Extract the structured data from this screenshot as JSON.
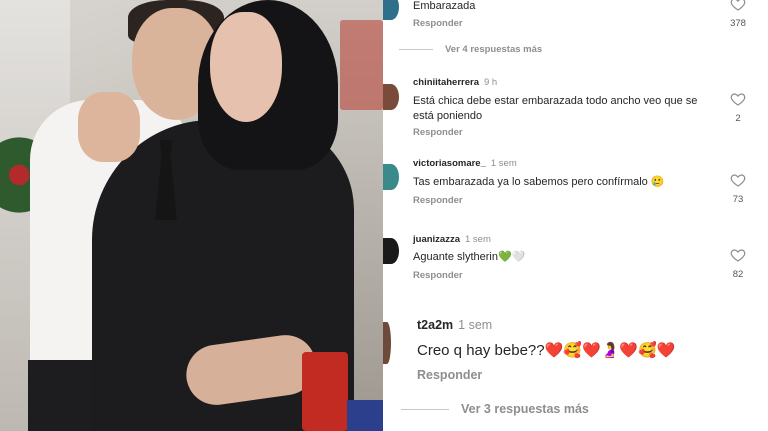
{
  "comments": [
    {
      "username": "",
      "time": "",
      "text": "Embarazada",
      "reply_label": "Responder",
      "likes": "378",
      "avatar_color": "#2e6f8a"
    },
    {
      "username": "chiniitaherrera",
      "time": "9 h",
      "text": "Está chica debe estar embarazada todo ancho veo que se está poniendo",
      "reply_label": "Responder",
      "likes": "2",
      "avatar_color": "#7a4a3a"
    },
    {
      "username": "victoriasomare_",
      "time": "1 sem",
      "text": "Tas embarazada ya lo sabemos pero confírmalo 🥲",
      "reply_label": "Responder",
      "likes": "73",
      "avatar_color": "#3a8a8c"
    },
    {
      "username": "juanizazza",
      "time": "1 sem",
      "text": "Aguante slytherin💚🤍",
      "reply_label": "Responder",
      "likes": "82",
      "avatar_color": "#1a1a1a"
    },
    {
      "username": "t2a2m",
      "time": "1 sem",
      "text": "Creo q hay bebe??❤️🥰❤️🤰❤️🥰❤️",
      "reply_label": "Responder",
      "avatar_color": "#6d4b3b"
    }
  ],
  "view_replies": [
    "Ver 4 respuestas más",
    "Ver 3 respuestas más"
  ],
  "colors": {
    "text": "#262626",
    "muted": "#8e8e8e",
    "heart_outline": "#8e8e8e"
  },
  "icons": {
    "like": "heart-outline-icon"
  }
}
